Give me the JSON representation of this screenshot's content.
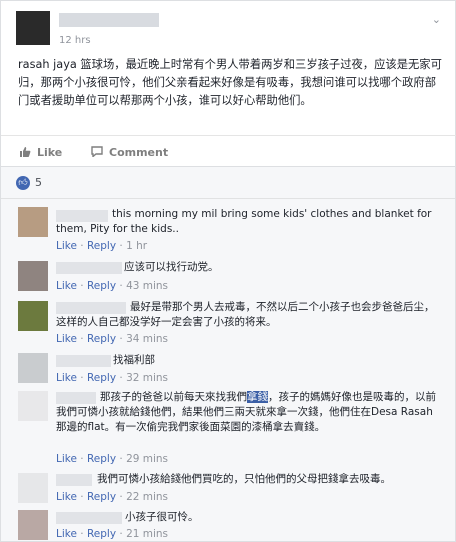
{
  "post": {
    "time": "12 hrs",
    "text": "rasah jaya 篮球场，最近晚上时常有个男人带着两岁和三岁孩子过夜，应该是无家可归，那两个小孩很可怜，他们父亲看起来好像是有吸毒，我想问谁可以找哪个政府部门或者援助单位可以帮那两个小孩，谁可以好心帮助他们。",
    "chevron_icon": "chevron-down-icon",
    "like_label": "Like",
    "comment_label": "Comment"
  },
  "reactions": {
    "count": "5"
  },
  "comments": [
    {
      "text": "this morning my mil bring some kids' clothes and blanket for them, Pity for the kids..",
      "like": "Like",
      "reply": "Reply",
      "time": "1 hr"
    },
    {
      "text": "应该可以找行动党。",
      "like": "Like",
      "reply": "Reply",
      "time": "43 mins"
    },
    {
      "text": "最好是带那个男人去戒毒，不然以后二个小孩子也会步爸爸后尘，这样的人自己都没学好一定会害了小孩的将来。",
      "like": "Like",
      "reply": "Reply",
      "time": "34 mins"
    },
    {
      "text": "找福利部",
      "like": "Like",
      "reply": "Reply",
      "time": "32 mins"
    },
    {
      "text_a": "那孩子的爸爸以前每天來找我們",
      "text_hl": "拿錢",
      "text_b": "，孩子的媽媽好像也是吸毒的，以前我們可憐小孩就給錢他們，結果他們三兩天就來拿一次錢，他們住在Desa Rasah那邊的flat。有一次偷完我們家後面菜園的漆桶拿去賣錢。",
      "like": "Like",
      "reply": "Reply",
      "time": "29 mins"
    },
    {
      "text": "我們可憐小孩給錢他們買吃的，只怕他們的父母把錢拿去吸毒。",
      "like": "Like",
      "reply": "Reply",
      "time": "22 mins"
    },
    {
      "text": "小孩子很可怜。",
      "like": "Like",
      "reply": "Reply",
      "time": "21 mins"
    }
  ],
  "colors": {
    "fb_blue": "#4267b2",
    "meta_grey": "#90949c",
    "highlight": "#3b5fa6"
  }
}
